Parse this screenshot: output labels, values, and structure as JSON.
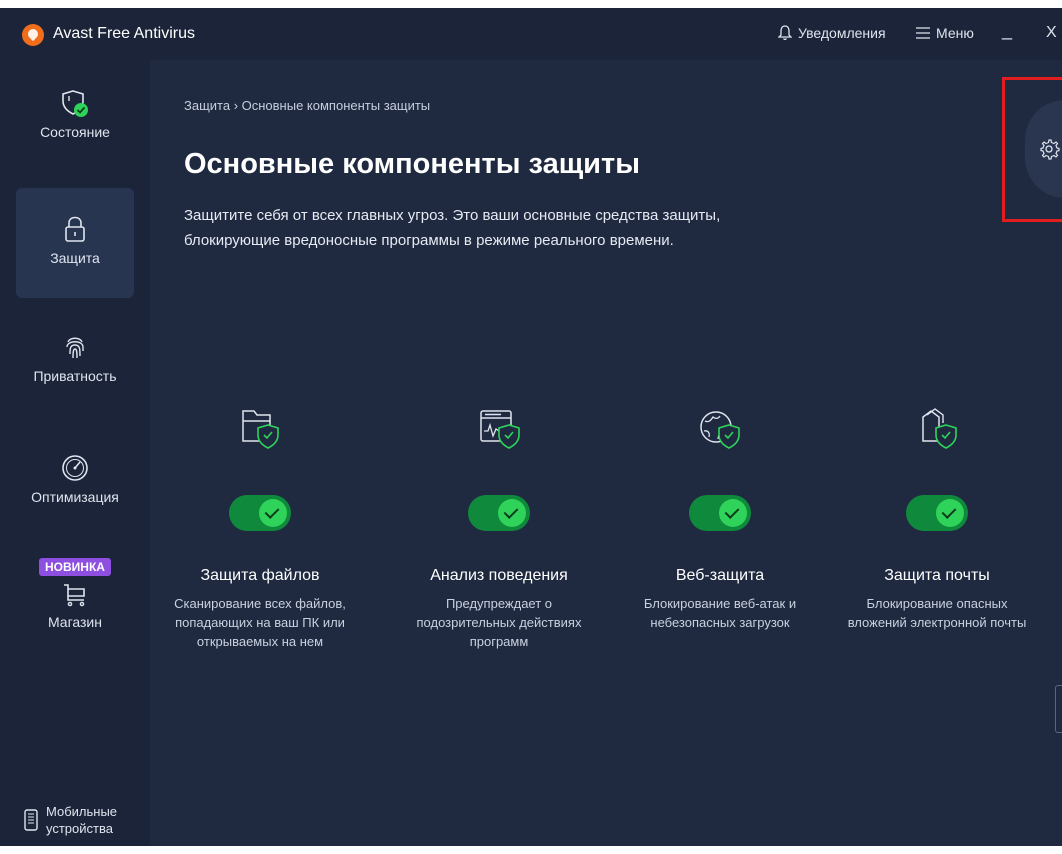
{
  "app": {
    "title": "Avast Free Antivirus"
  },
  "titlebar": {
    "notifications": "Уведомления",
    "menu": "Меню",
    "minimize": "_",
    "close": "X"
  },
  "sidebar": {
    "items": [
      {
        "label": "Состояние",
        "icon": "shield-check-icon"
      },
      {
        "label": "Защита",
        "icon": "lock-icon",
        "active": true
      },
      {
        "label": "Приватность",
        "icon": "fingerprint-icon"
      },
      {
        "label": "Оптимизация",
        "icon": "speedometer-icon"
      },
      {
        "label": "Магазин",
        "icon": "cart-icon",
        "badge": "НОВИНКА"
      }
    ],
    "mobile": "Мобильные устройства"
  },
  "main": {
    "breadcrumb": "Защита › Основные компоненты защиты",
    "title": "Основные компоненты защиты",
    "description": "Защитите себя от всех главных угроз. Это ваши основные средства защиты, блокирующие вредоносные программы в режиме реального времени.",
    "features": [
      {
        "title": "Защита файлов",
        "desc": "Сканирование всех файлов, попадающих на ваш ПК или открываемых на нем",
        "icon": "folder-shield-icon",
        "enabled": true
      },
      {
        "title": "Анализ поведения",
        "desc": "Предупреждает о подозрительных действиях программ",
        "icon": "activity-window-shield-icon",
        "enabled": true
      },
      {
        "title": "Веб-защита",
        "desc": "Блокирование веб-атак и небезопасных загрузок",
        "icon": "globe-shield-icon",
        "enabled": true
      },
      {
        "title": "Защита почты",
        "desc": "Блокирование опасных вложений электронной почты",
        "icon": "mail-shield-icon",
        "enabled": true
      }
    ]
  },
  "colors": {
    "background": "#1f2a40",
    "sidebar": "#1b2438",
    "toggle_on": "#0f8a3c",
    "accent_green": "#2fd35a",
    "badge": "#8e4fe0",
    "highlight_box": "#e01e1e"
  }
}
